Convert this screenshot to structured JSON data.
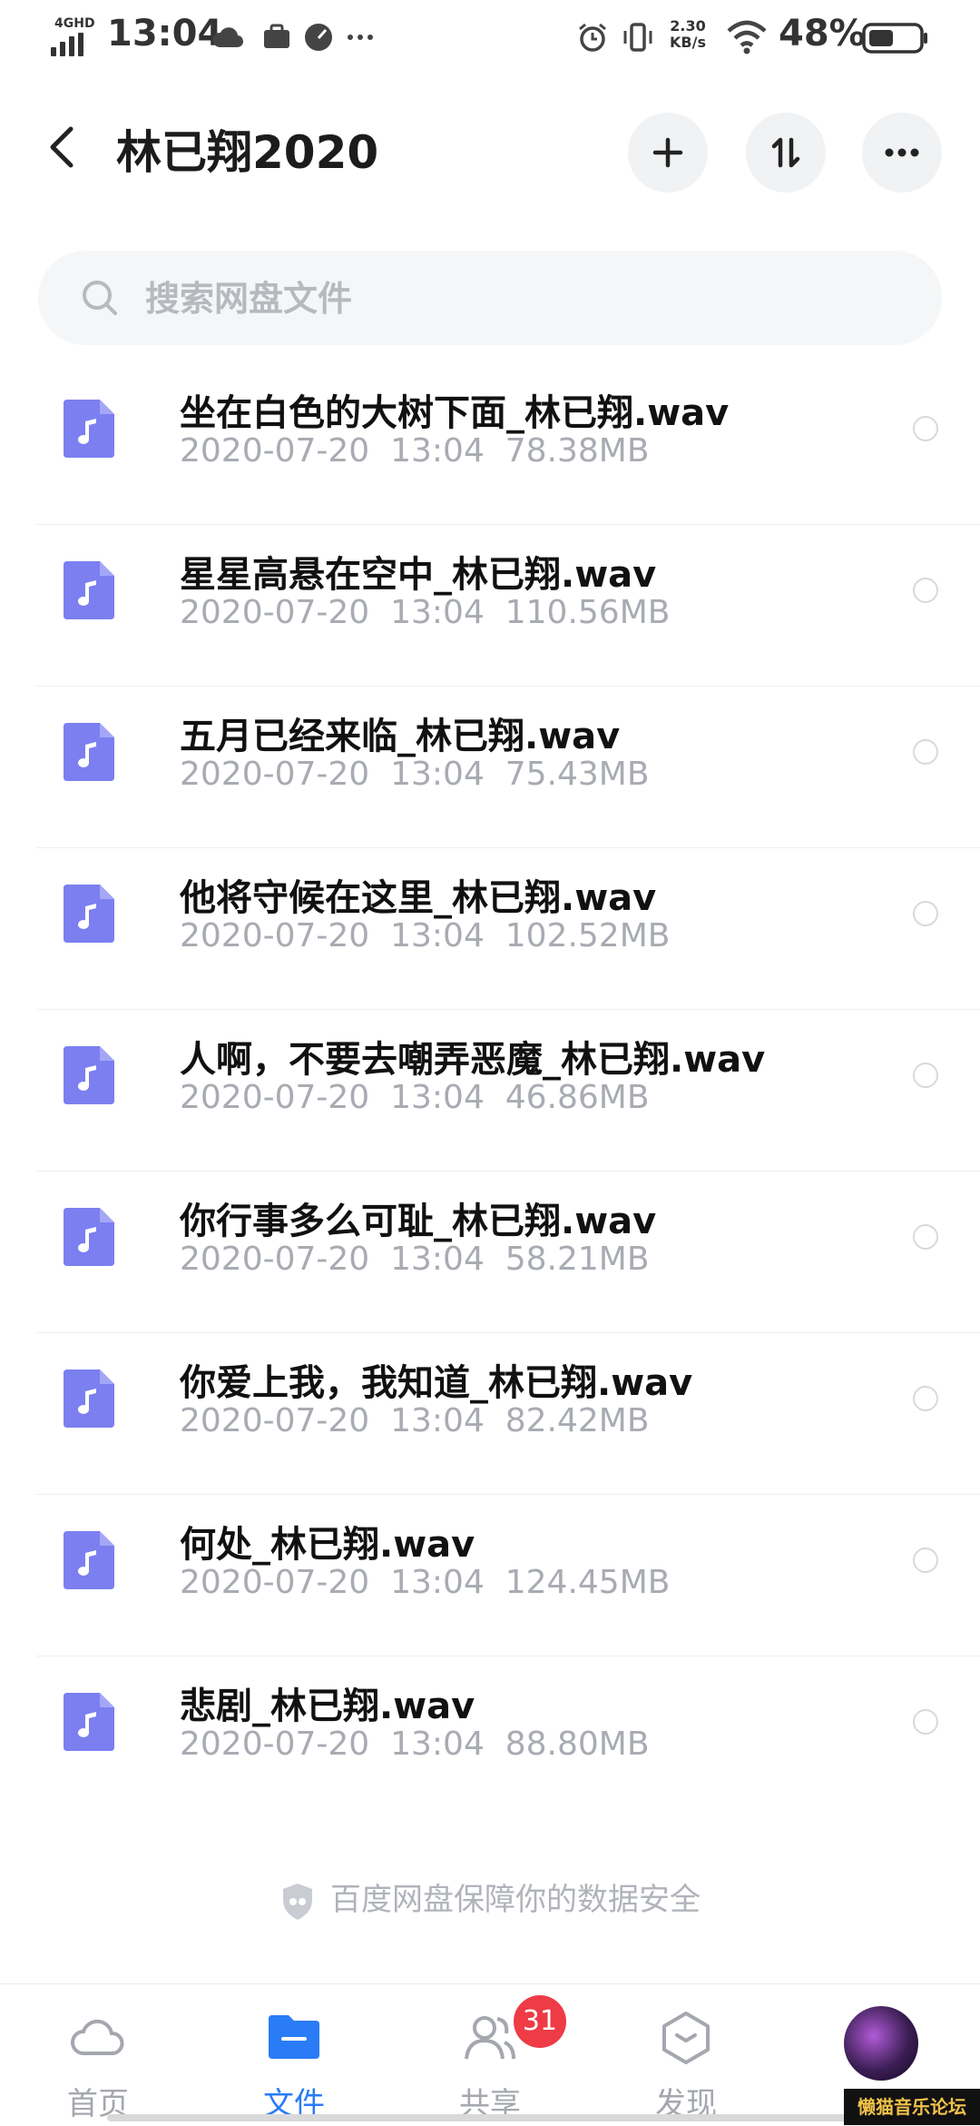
{
  "status_bar": {
    "network": "4GHD",
    "time": "13:04",
    "speed_value": "2.30",
    "speed_unit": "KB/s",
    "battery": "48%"
  },
  "header": {
    "title": "林已翔2020"
  },
  "search": {
    "placeholder": "搜索网盘文件"
  },
  "files": [
    {
      "name": "坐在白色的大树下面_林已翔.wav",
      "date": "2020-07-20",
      "time": "13:04",
      "size": "78.38MB"
    },
    {
      "name": "星星高悬在空中_林已翔.wav",
      "date": "2020-07-20",
      "time": "13:04",
      "size": "110.56MB"
    },
    {
      "name": "五月已经来临_林已翔.wav",
      "date": "2020-07-20",
      "time": "13:04",
      "size": "75.43MB"
    },
    {
      "name": "他将守候在这里_林已翔.wav",
      "date": "2020-07-20",
      "time": "13:04",
      "size": "102.52MB"
    },
    {
      "name": "人啊，不要去嘲弄恶魔_林已翔.wav",
      "date": "2020-07-20",
      "time": "13:04",
      "size": "46.86MB"
    },
    {
      "name": "你行事多么可耻_林已翔.wav",
      "date": "2020-07-20",
      "time": "13:04",
      "size": "58.21MB"
    },
    {
      "name": "你爱上我，我知道_林已翔.wav",
      "date": "2020-07-20",
      "time": "13:04",
      "size": "82.42MB"
    },
    {
      "name": "何处_林已翔.wav",
      "date": "2020-07-20",
      "time": "13:04",
      "size": "124.45MB"
    },
    {
      "name": "悲剧_林已翔.wav",
      "date": "2020-07-20",
      "time": "13:04",
      "size": "88.80MB"
    }
  ],
  "safety_note": "百度网盘保障你的数据安全",
  "tabbar": {
    "home": "首页",
    "files": "文件",
    "share": "共享",
    "share_badge": "31",
    "discover": "发现"
  },
  "watermark": "懒猫音乐论坛",
  "colors": {
    "accent": "#2a7cf6",
    "file_icon": "#7b7ff0",
    "badge": "#ee3b45"
  }
}
